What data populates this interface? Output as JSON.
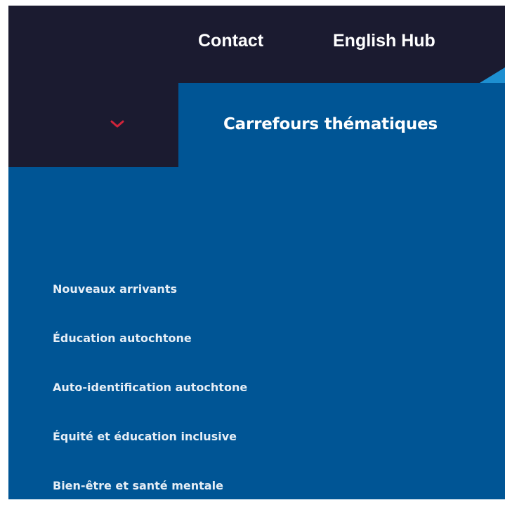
{
  "header": {
    "links": {
      "contact": "Contact",
      "english_hub": "English Hub"
    }
  },
  "nav": {
    "dropdown_icon": "chevron-down-icon",
    "title": "Carrefours thématiques"
  },
  "menu": {
    "items": [
      {
        "label": "Nouveaux arrivants"
      },
      {
        "label": "Éducation autochtone"
      },
      {
        "label": "Auto-identification autochtone"
      },
      {
        "label": "Équité et éducation inclusive"
      },
      {
        "label": "Bien-être et santé mentale"
      }
    ]
  },
  "colors": {
    "header_bg": "#1b1b30",
    "panel_bg": "#005595",
    "accent_red": "#d0243a",
    "accent_blue": "#1d8fd1"
  }
}
